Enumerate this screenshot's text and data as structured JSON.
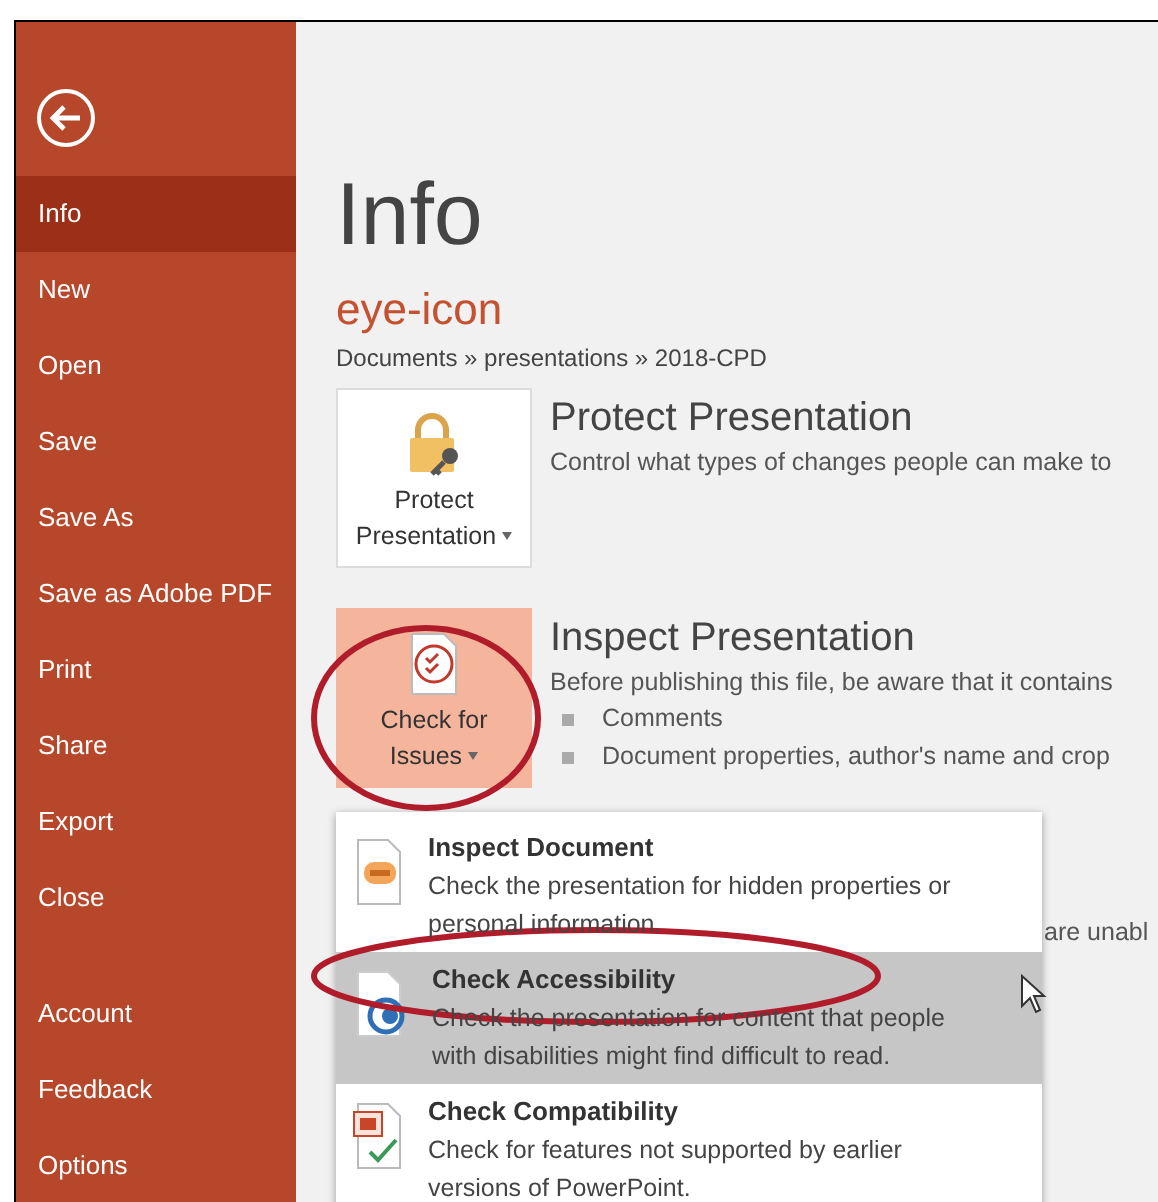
{
  "sidebar": {
    "items": [
      {
        "label": "Info",
        "selected": true
      },
      {
        "label": "New",
        "selected": false
      },
      {
        "label": "Open",
        "selected": false
      },
      {
        "label": "Save",
        "selected": false
      },
      {
        "label": "Save As",
        "selected": false
      },
      {
        "label": "Save as Adobe PDF",
        "selected": false
      },
      {
        "label": "Print",
        "selected": false
      },
      {
        "label": "Share",
        "selected": false
      },
      {
        "label": "Export",
        "selected": false
      },
      {
        "label": "Close",
        "selected": false
      }
    ],
    "bottom_items": [
      {
        "label": "Account",
        "selected": false
      },
      {
        "label": "Feedback",
        "selected": false
      },
      {
        "label": "Options",
        "selected": false
      }
    ]
  },
  "main": {
    "title": "Info",
    "file_name": "eye-icon",
    "path": "Documents » presentations » 2018-CPD",
    "sections": [
      {
        "kind": "protect",
        "button_lines": [
          "Protect",
          "Presentation"
        ],
        "highlighted": false,
        "heading": "Protect Presentation",
        "description": "Control what types of changes people can make to"
      },
      {
        "kind": "inspect",
        "button_lines": [
          "Check for",
          "Issues"
        ],
        "highlighted": true,
        "heading": "Inspect Presentation",
        "description": "Before publishing this file, be aware that it contains",
        "bullets": [
          "Comments",
          "Document properties, author's name and crop"
        ],
        "covered_text": "are unabl"
      }
    ]
  },
  "menu": {
    "items": [
      {
        "kind": "inspect",
        "title": "Inspect Document",
        "description": "Check the presentation for hidden properties or personal information.",
        "selected": false
      },
      {
        "kind": "accessibility",
        "title": "Check Accessibility",
        "description": "Check the presentation for content that people with disabilities might find difficult to read.",
        "selected": true
      },
      {
        "kind": "compatibility",
        "title": "Check Compatibility",
        "description": "Check for features not supported by earlier versions of PowerPoint.",
        "selected": false
      }
    ]
  }
}
